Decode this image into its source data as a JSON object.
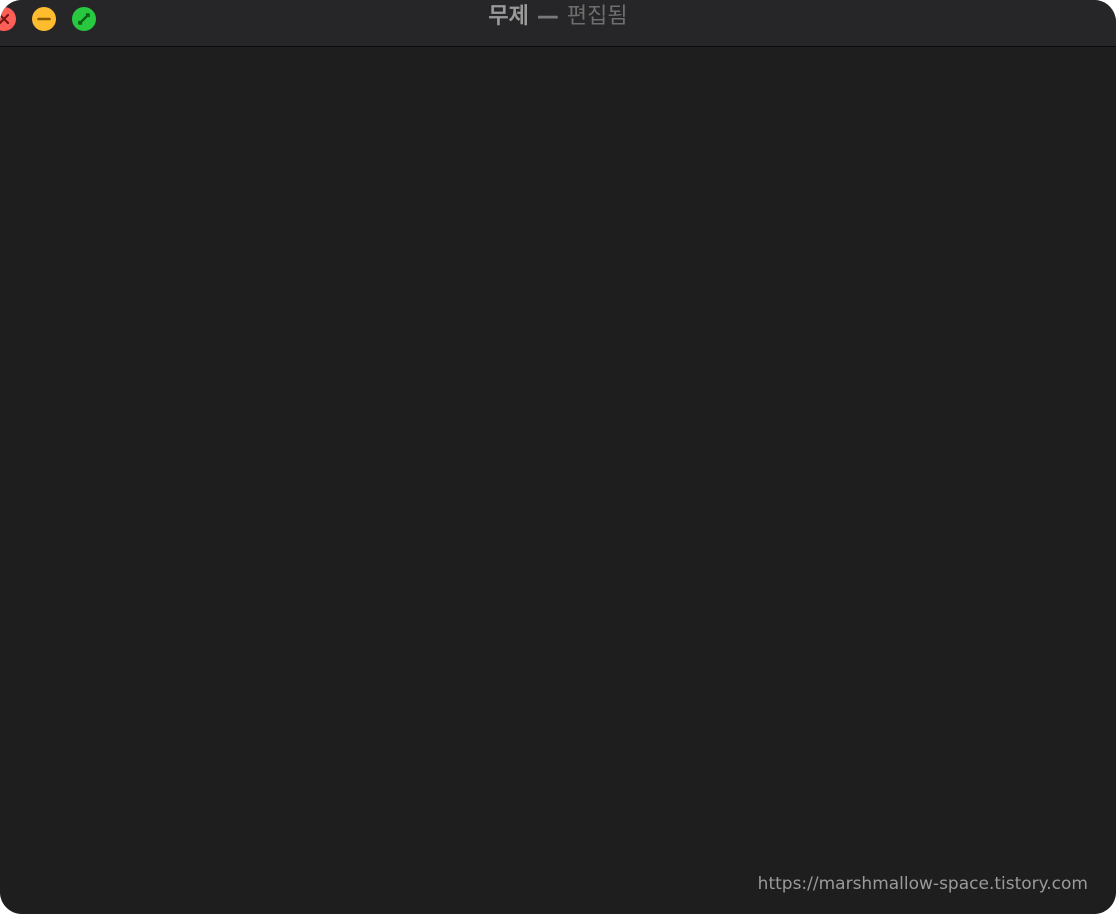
{
  "window": {
    "title": "무제",
    "separator": "—",
    "status": "편집됨"
  },
  "controls": {
    "close_color": "#ff5f57",
    "minimize_color": "#febc2e",
    "zoom_color": "#28c840"
  },
  "watermark": "https://marshmallow-space.tistory.com"
}
